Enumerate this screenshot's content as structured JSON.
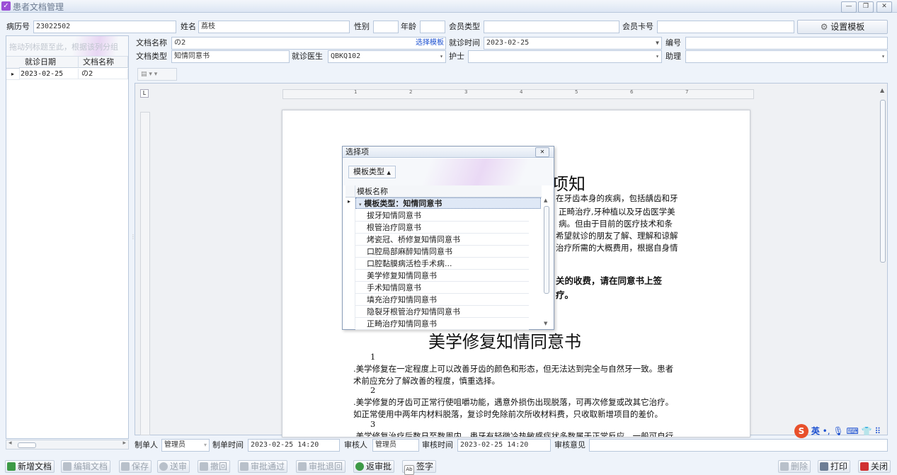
{
  "window": {
    "title": "患者文档管理"
  },
  "header": {
    "record_no_label": "病历号",
    "record_no": "23022502",
    "name_label": "姓名",
    "name": "荔枝",
    "gender_label": "性别",
    "gender": "",
    "age_label": "年龄",
    "age": "",
    "member_type_label": "会员类型",
    "member_type": "",
    "member_card_label": "会员卡号",
    "member_card": "",
    "settings_button": "设置模板"
  },
  "form": {
    "doc_name_label": "文档名称",
    "doc_name": "の2",
    "select_template_link": "选择模板",
    "visit_time_label": "就诊时间",
    "visit_time": "2023-02-25",
    "number_label": "编号",
    "number": "",
    "doc_type_label": "文档类型",
    "doc_type": "知情同意书",
    "doctor_label": "就诊医生",
    "doctor": "QBKQ102",
    "nurse_label": "护士",
    "nurse": "",
    "assistant_label": "助理",
    "assistant": ""
  },
  "left_grid": {
    "group_hint": "拖动列标题至此，根据该列分组",
    "columns": [
      "就诊日期",
      "文档名称"
    ],
    "rows": [
      {
        "date": "2023-02-25",
        "name": "の2"
      }
    ]
  },
  "document": {
    "title_fragment": "项知",
    "para1": [
      "在牙齿本身的疾病，包括龋齿和牙",
      "正畸治疗,牙种植以及牙齿医学美",
      "病。但由于目前的医疗技术和条",
      "希望就诊的朋友了解、理解和谅解",
      "治疗所需的大概费用，根据自身情"
    ],
    "bold1": "关的收费，请在同意书上签",
    "bold2": "疗。",
    "heading2": "美学修复知情同意书",
    "num1": "1",
    "line1a": ".美学修复在一定程度上可以改善牙齿的颜色和形态，但无法达到完全与自然牙一致。患者",
    "line1b": "术前应充分了解改善的程度，慎重选择。",
    "num2": "2",
    "line2a": ".美学修复的牙齿可正常行使咀嚼功能，遇意外损伤出现脱落，可再次修复或改其它治疗。",
    "line2b": "如正常使用中两年内材料脱落，复诊时免除前次所收材料费，只收取新增项目的差价。",
    "num3": "3",
    "line3a": ".美学修复治疗后数日至数周内，患牙有轻微冷热敏感症状多数属于正常反应，一般可自行"
  },
  "popup": {
    "title": "选择项",
    "group_chip": "模板类型",
    "column": "模板名称",
    "group_row": "模板类型：知情同意书",
    "items": [
      "拔牙知情同意书",
      "根管治疗同意书",
      "烤瓷冠、桥修复知情同意书",
      "口腔局部麻醉知情同意书",
      "口腔黏膜病活检手术病...",
      "美学修复知情同意书",
      "手术知情同意书",
      "填充治疗知情同意书",
      "隐裂牙根管治疗知情同意书",
      "正畸治疗知情同意书"
    ]
  },
  "footer": {
    "maker_label": "制单人",
    "maker": "管理员",
    "make_time_label": "制单时间",
    "make_time": "2023-02-25 14:20",
    "reviewer_label": "审核人",
    "reviewer": "管理员",
    "review_time_label": "审核时间",
    "review_time": "2023-02-25 14:20",
    "review_opinion_label": "审核意见",
    "review_opinion": ""
  },
  "toolbar": {
    "new_doc": "新增文档",
    "edit_doc": "编辑文档",
    "save": "保存",
    "submit": "送审",
    "withdraw": "撤回",
    "approve": "审批通过",
    "reject": "审批退回",
    "unapprove": "返审批",
    "sign": "签字",
    "delete": "删除",
    "print": "打印",
    "close": "关闭"
  },
  "ime": {
    "lang": "英"
  },
  "colors": {
    "accent": "#9b4fd6",
    "link": "#1a4fd0",
    "selection": "#dfe8f6"
  }
}
